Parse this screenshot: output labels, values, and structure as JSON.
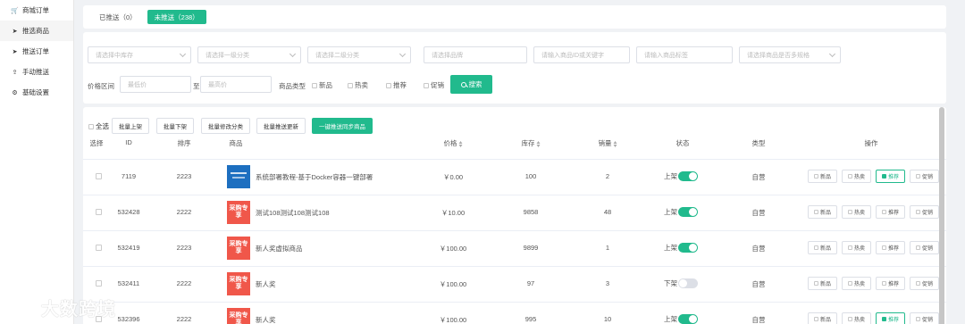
{
  "sidebar": {
    "items": [
      {
        "label": "商城订单",
        "icon": "cart-icon"
      },
      {
        "label": "推选商品",
        "icon": "send-icon"
      },
      {
        "label": "推送订单",
        "icon": "send-icon"
      },
      {
        "label": "手动推送",
        "icon": "upload-icon"
      },
      {
        "label": "基础设置",
        "icon": "gear-icon"
      }
    ]
  },
  "tabs": [
    {
      "label": "已推送（0）"
    },
    {
      "label": "未推送（238）"
    }
  ],
  "filters": {
    "warehouse_placeholder": "请选择中库存",
    "cat1_placeholder": "请选择一级分类",
    "cat2_placeholder": "请选择二级分类",
    "brand_placeholder": "请选择品牌",
    "keyword_placeholder": "请输入商品ID或关键字",
    "title_placeholder": "请输入商品标签",
    "spec_placeholder": "请选择商品是否多规格",
    "price_label": "价格区间",
    "min_price_placeholder": "最低价",
    "to_label": "至",
    "max_price_placeholder": "最高价",
    "type_label": "商品类型",
    "type_new": "新品",
    "type_hot": "热卖",
    "type_rec": "推荐",
    "type_promo": "促销",
    "search_label": "搜索"
  },
  "bulk": {
    "select_all": "全选",
    "up": "批量上架",
    "down": "批量下架",
    "edit_cat": "批量修改分类",
    "push_update": "批量推送更新",
    "sync": "一键推送同步商品"
  },
  "table": {
    "headers": {
      "select": "选择",
      "id": "ID",
      "sort": "排序",
      "product": "商品",
      "price": "价格",
      "stock": "库存",
      "sales": "销量",
      "status": "状态",
      "type": "类型",
      "ops": "操作"
    },
    "op_labels": {
      "new": "新品",
      "hot": "热卖",
      "rec": "推荐",
      "promo": "促销"
    },
    "rows": [
      {
        "id": "7119",
        "sort": "2223",
        "name": "系统部署教程-基于Docker容器一键部署",
        "thumb": "blue",
        "thumb_text": "",
        "price": "￥0.00",
        "stock": "100",
        "sales": "2",
        "status": "上架",
        "on": true,
        "type": "自营",
        "rec": true
      },
      {
        "id": "532428",
        "sort": "2222",
        "name": "测试108测试108测试108",
        "thumb": "red",
        "thumb_text": "采购专享",
        "price": "￥10.00",
        "stock": "9858",
        "sales": "48",
        "status": "上架",
        "on": true,
        "type": "自营",
        "rec": false
      },
      {
        "id": "532419",
        "sort": "2223",
        "name": "新人奖虚拟商品",
        "thumb": "red",
        "thumb_text": "采购专享",
        "price": "￥100.00",
        "stock": "9899",
        "sales": "1",
        "status": "上架",
        "on": true,
        "type": "自营",
        "rec": false
      },
      {
        "id": "532411",
        "sort": "2222",
        "name": "新人奖",
        "thumb": "red",
        "thumb_text": "采购专享",
        "price": "￥100.00",
        "stock": "97",
        "sales": "3",
        "status": "下架",
        "on": false,
        "type": "自营",
        "rec": false
      },
      {
        "id": "532396",
        "sort": "2222",
        "name": "新人奖",
        "thumb": "red",
        "thumb_text": "采购专享",
        "price": "￥100.00",
        "stock": "995",
        "sales": "10",
        "status": "上架",
        "on": true,
        "type": "自营",
        "rec": true
      }
    ]
  },
  "watermark": {
    "text": "大数跨境"
  },
  "colors": {
    "accent": "#21ba8d",
    "thumb_red": "#f0574a",
    "thumb_blue": "#1d6fc0"
  }
}
